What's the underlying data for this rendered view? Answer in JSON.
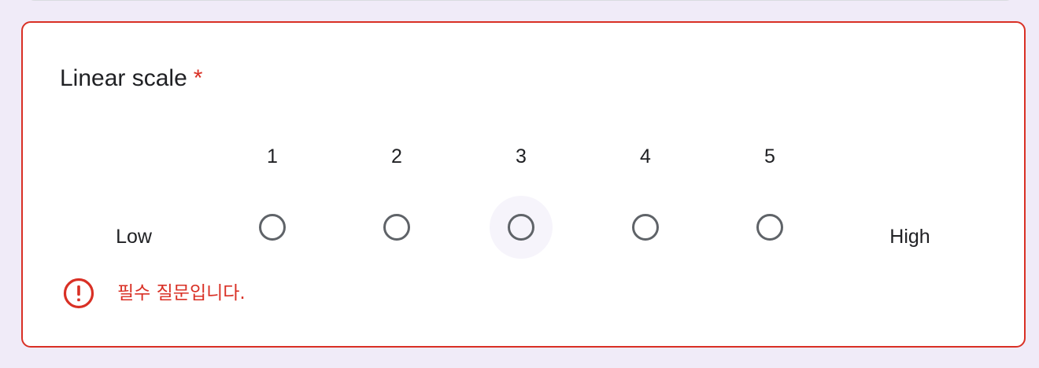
{
  "question": {
    "title": "Linear scale",
    "required_marker": "*",
    "scale": {
      "numbers": [
        "1",
        "2",
        "3",
        "4",
        "5"
      ],
      "low_label": "Low",
      "high_label": "High",
      "hovered_option": "3",
      "selected_option": null
    },
    "error": {
      "icon": "error-icon",
      "message": "필수 질문입니다."
    }
  },
  "colors": {
    "page_background": "#f0ebf8",
    "card_background": "#ffffff",
    "error_red": "#d93025",
    "radio_border": "#5f6368",
    "text": "#202124",
    "hover_halo": "#f6f4fb"
  }
}
